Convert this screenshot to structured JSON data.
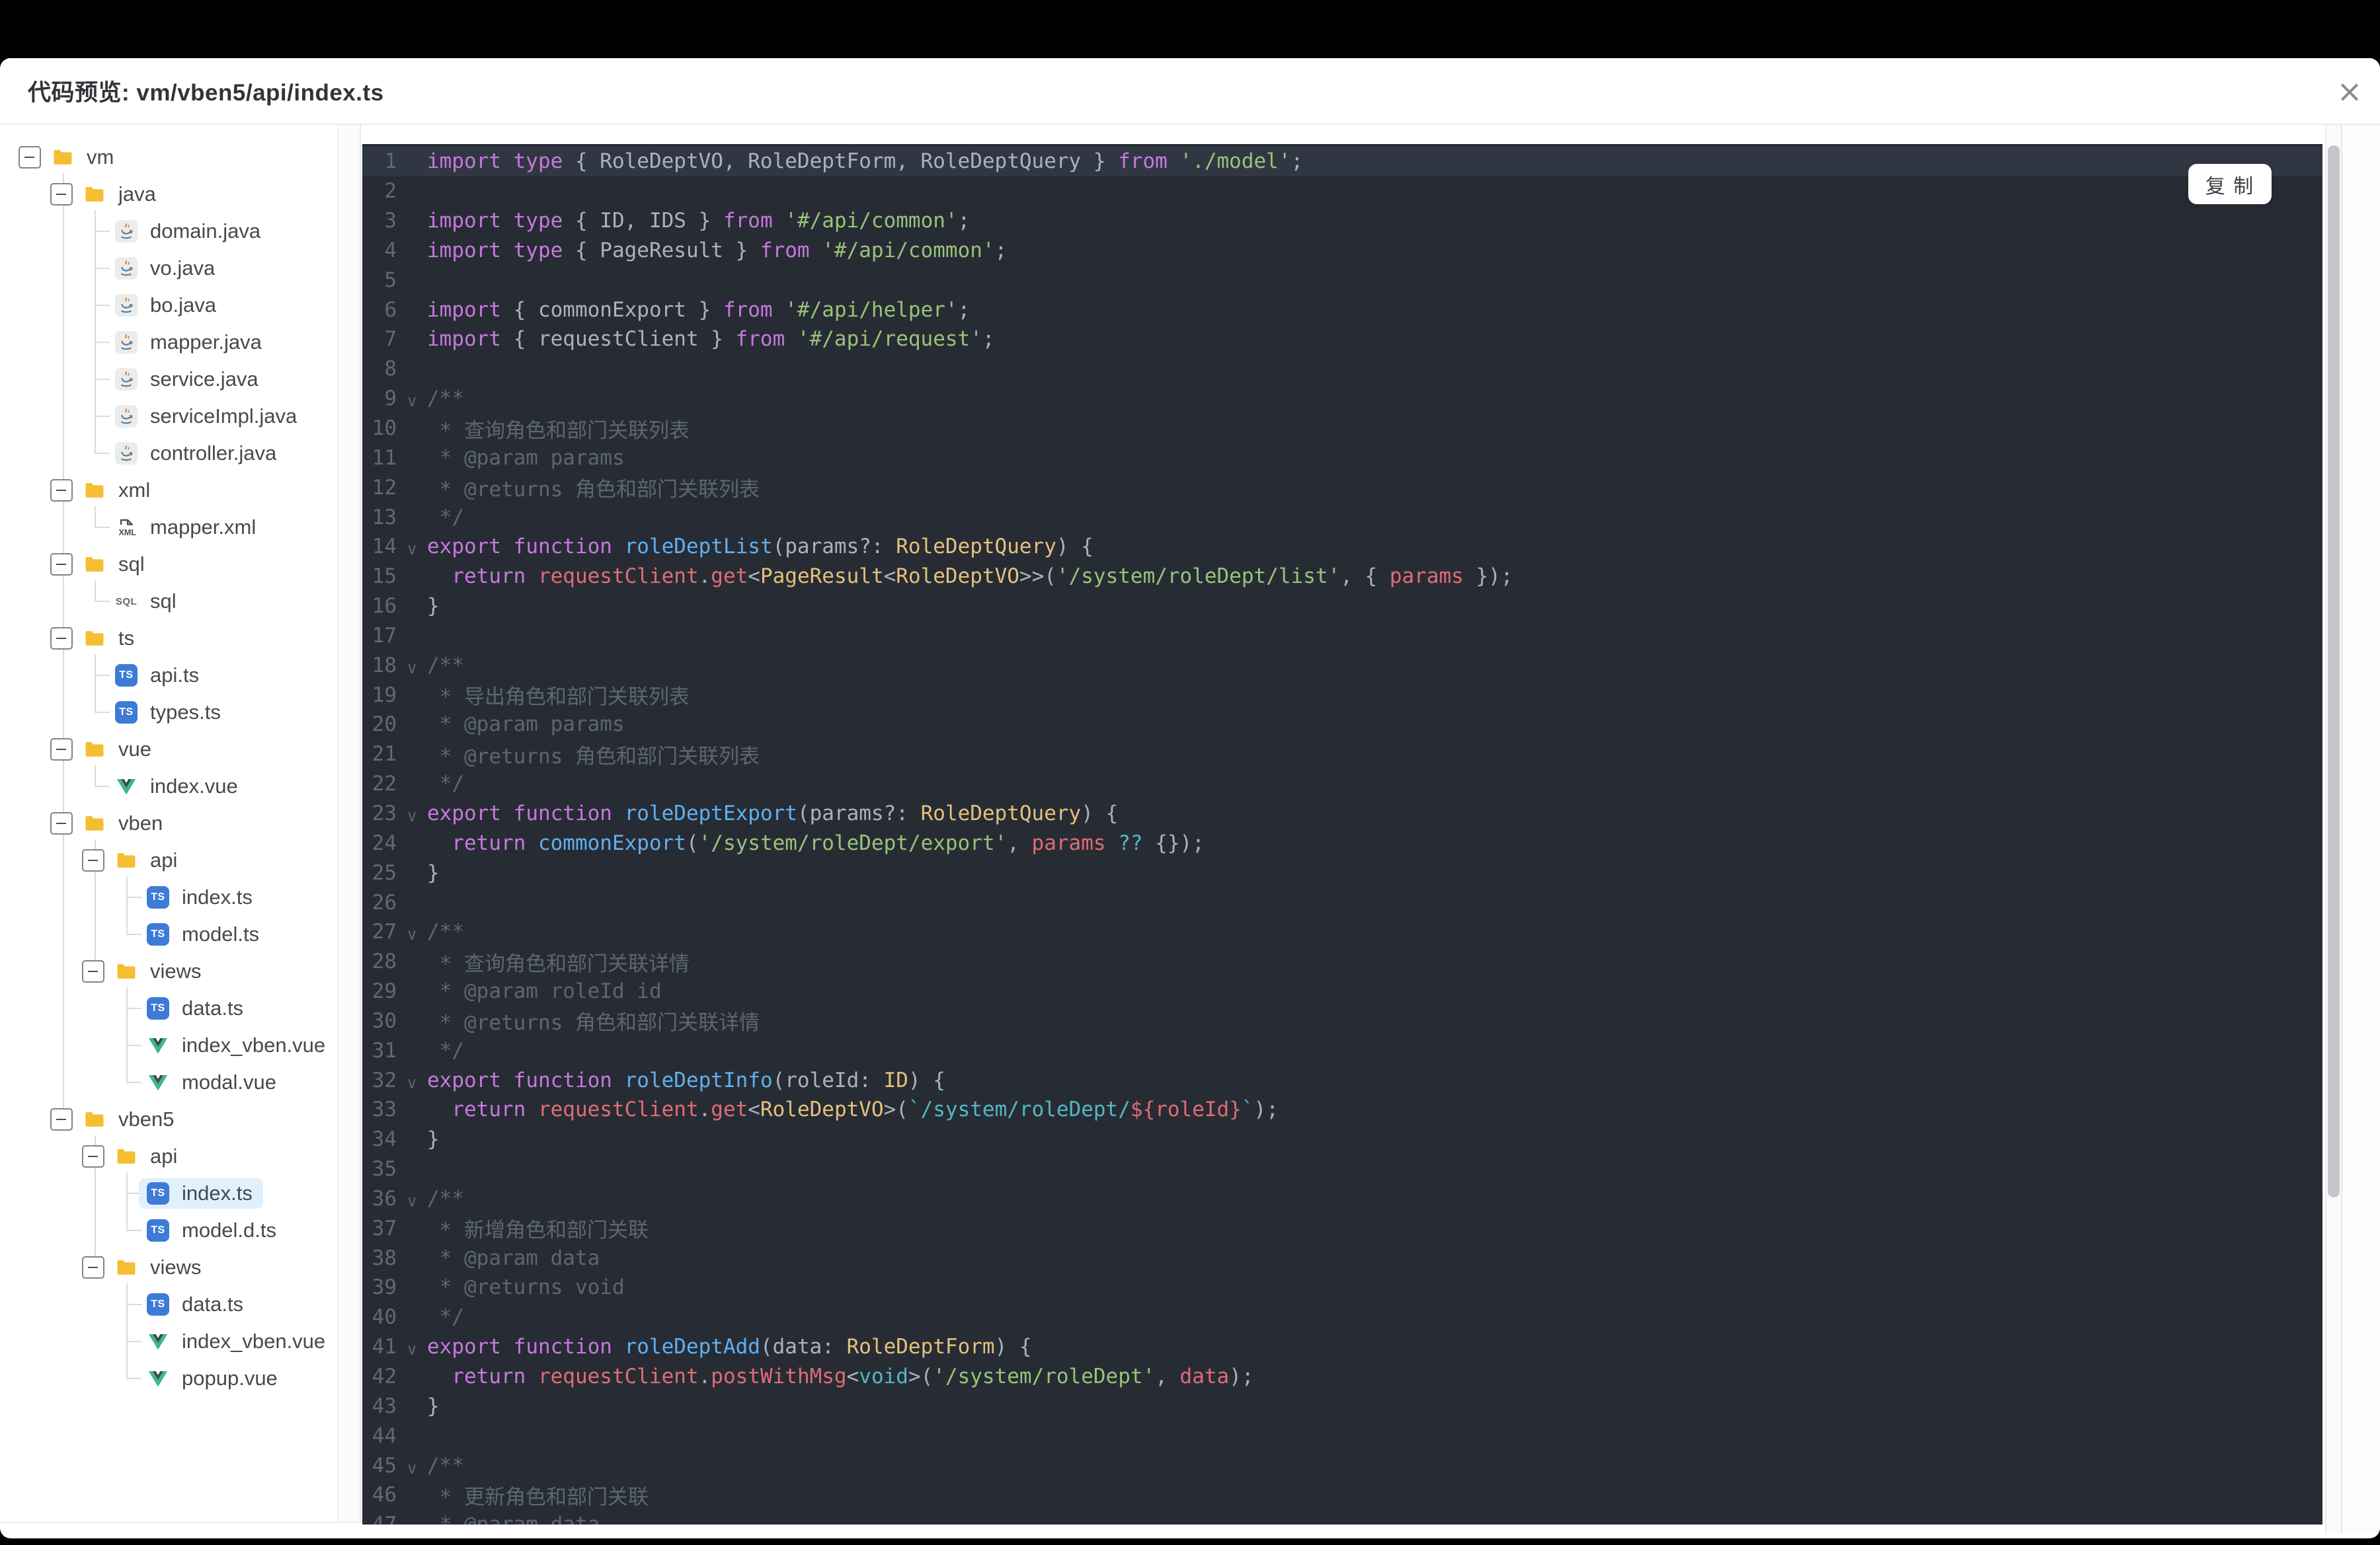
{
  "header": {
    "title": "代码预览: vm/vben5/api/index.ts",
    "close_glyph": "×"
  },
  "code_panel": {
    "copy_label": "复 制"
  },
  "tree": {
    "rows": [
      {
        "level": 0,
        "icon": "folder",
        "label": "vm",
        "toggle": true
      },
      {
        "level": 1,
        "icon": "folder",
        "label": "java",
        "toggle": true
      },
      {
        "level": 2,
        "icon": "java",
        "label": "domain.java"
      },
      {
        "level": 2,
        "icon": "java",
        "label": "vo.java"
      },
      {
        "level": 2,
        "icon": "java",
        "label": "bo.java"
      },
      {
        "level": 2,
        "icon": "java",
        "label": "mapper.java"
      },
      {
        "level": 2,
        "icon": "java",
        "label": "service.java"
      },
      {
        "level": 2,
        "icon": "java",
        "label": "serviceImpl.java"
      },
      {
        "level": 2,
        "icon": "java",
        "label": "controller.java"
      },
      {
        "level": 1,
        "icon": "folder",
        "label": "xml",
        "toggle": true
      },
      {
        "level": 2,
        "icon": "xml",
        "label": "mapper.xml"
      },
      {
        "level": 1,
        "icon": "folder",
        "label": "sql",
        "toggle": true
      },
      {
        "level": 2,
        "icon": "sql",
        "label": "sql"
      },
      {
        "level": 1,
        "icon": "folder",
        "label": "ts",
        "toggle": true
      },
      {
        "level": 2,
        "icon": "ts",
        "label": "api.ts"
      },
      {
        "level": 2,
        "icon": "ts",
        "label": "types.ts"
      },
      {
        "level": 1,
        "icon": "folder",
        "label": "vue",
        "toggle": true
      },
      {
        "level": 2,
        "icon": "vue",
        "label": "index.vue"
      },
      {
        "level": 1,
        "icon": "folder",
        "label": "vben",
        "toggle": true
      },
      {
        "level": 2,
        "icon": "folder",
        "label": "api",
        "toggle": true
      },
      {
        "level": 3,
        "icon": "ts",
        "label": "index.ts"
      },
      {
        "level": 3,
        "icon": "ts",
        "label": "model.ts"
      },
      {
        "level": 2,
        "icon": "folder",
        "label": "views",
        "toggle": true
      },
      {
        "level": 3,
        "icon": "ts",
        "label": "data.ts"
      },
      {
        "level": 3,
        "icon": "vue",
        "label": "index_vben.vue"
      },
      {
        "level": 3,
        "icon": "vue",
        "label": "modal.vue"
      },
      {
        "level": 1,
        "icon": "folder",
        "label": "vben5",
        "toggle": true
      },
      {
        "level": 2,
        "icon": "folder",
        "label": "api",
        "toggle": true
      },
      {
        "level": 3,
        "icon": "ts",
        "label": "index.ts",
        "selected": true
      },
      {
        "level": 3,
        "icon": "ts",
        "label": "model.d.ts"
      },
      {
        "level": 2,
        "icon": "folder",
        "label": "views",
        "toggle": true
      },
      {
        "level": 3,
        "icon": "ts",
        "label": "data.ts"
      },
      {
        "level": 3,
        "icon": "vue",
        "label": "index_vben.vue"
      },
      {
        "level": 3,
        "icon": "vue",
        "label": "popup.vue"
      }
    ]
  },
  "code": {
    "lines": [
      {
        "n": 1,
        "active": true,
        "t": [
          [
            "k",
            "import type"
          ],
          [
            "d",
            " { RoleDeptVO, RoleDeptForm, RoleDeptQuery } "
          ],
          [
            "k",
            "from"
          ],
          [
            "d",
            " "
          ],
          [
            "s",
            "'./model'"
          ],
          [
            "d",
            ";"
          ]
        ]
      },
      {
        "n": 2,
        "t": []
      },
      {
        "n": 3,
        "t": [
          [
            "k",
            "import type"
          ],
          [
            "d",
            " { ID, IDS } "
          ],
          [
            "k",
            "from"
          ],
          [
            "d",
            " "
          ],
          [
            "s",
            "'#/api/common'"
          ],
          [
            "d",
            ";"
          ]
        ]
      },
      {
        "n": 4,
        "t": [
          [
            "k",
            "import type"
          ],
          [
            "d",
            " { PageResult } "
          ],
          [
            "k",
            "from"
          ],
          [
            "d",
            " "
          ],
          [
            "s",
            "'#/api/common'"
          ],
          [
            "d",
            ";"
          ]
        ]
      },
      {
        "n": 5,
        "t": []
      },
      {
        "n": 6,
        "t": [
          [
            "k",
            "import"
          ],
          [
            "d",
            " { commonExport } "
          ],
          [
            "k",
            "from"
          ],
          [
            "d",
            " "
          ],
          [
            "s",
            "'#/api/helper'"
          ],
          [
            "d",
            ";"
          ]
        ]
      },
      {
        "n": 7,
        "t": [
          [
            "k",
            "import"
          ],
          [
            "d",
            " { requestClient } "
          ],
          [
            "k",
            "from"
          ],
          [
            "d",
            " "
          ],
          [
            "s",
            "'#/api/request'"
          ],
          [
            "d",
            ";"
          ]
        ]
      },
      {
        "n": 8,
        "t": []
      },
      {
        "n": 9,
        "fold": true,
        "t": [
          [
            "c",
            "/**"
          ]
        ]
      },
      {
        "n": 10,
        "t": [
          [
            "c",
            " * 查询角色和部门关联列表"
          ]
        ]
      },
      {
        "n": 11,
        "t": [
          [
            "c",
            " * @param params"
          ]
        ]
      },
      {
        "n": 12,
        "t": [
          [
            "c",
            " * @returns 角色和部门关联列表"
          ]
        ]
      },
      {
        "n": 13,
        "t": [
          [
            "c",
            " */"
          ]
        ]
      },
      {
        "n": 14,
        "fold": true,
        "t": [
          [
            "k",
            "export"
          ],
          [
            "d",
            " "
          ],
          [
            "k",
            "function"
          ],
          [
            "d",
            " "
          ],
          [
            "f",
            "roleDeptList"
          ],
          [
            "d",
            "(params?: "
          ],
          [
            "t",
            "RoleDeptQuery"
          ],
          [
            "d",
            ") {"
          ]
        ]
      },
      {
        "n": 15,
        "t": [
          [
            "d",
            "  "
          ],
          [
            "k",
            "return"
          ],
          [
            "d",
            " "
          ],
          [
            "r",
            "requestClient"
          ],
          [
            "d",
            "."
          ],
          [
            "r",
            "get"
          ],
          [
            "d",
            "<"
          ],
          [
            "t",
            "PageResult"
          ],
          [
            "d",
            "<"
          ],
          [
            "t",
            "RoleDeptVO"
          ],
          [
            "d",
            ">>("
          ],
          [
            "s",
            "'/system/roleDept/list'"
          ],
          [
            "d",
            ", { "
          ],
          [
            "r",
            "params"
          ],
          [
            "d",
            " });"
          ]
        ]
      },
      {
        "n": 16,
        "t": [
          [
            "d",
            "}"
          ]
        ]
      },
      {
        "n": 17,
        "t": []
      },
      {
        "n": 18,
        "fold": true,
        "t": [
          [
            "c",
            "/**"
          ]
        ]
      },
      {
        "n": 19,
        "t": [
          [
            "c",
            " * 导出角色和部门关联列表"
          ]
        ]
      },
      {
        "n": 20,
        "t": [
          [
            "c",
            " * @param params"
          ]
        ]
      },
      {
        "n": 21,
        "t": [
          [
            "c",
            " * @returns 角色和部门关联列表"
          ]
        ]
      },
      {
        "n": 22,
        "t": [
          [
            "c",
            " */"
          ]
        ]
      },
      {
        "n": 23,
        "fold": true,
        "t": [
          [
            "k",
            "export"
          ],
          [
            "d",
            " "
          ],
          [
            "k",
            "function"
          ],
          [
            "d",
            " "
          ],
          [
            "f",
            "roleDeptExport"
          ],
          [
            "d",
            "(params?: "
          ],
          [
            "t",
            "RoleDeptQuery"
          ],
          [
            "d",
            ") {"
          ]
        ]
      },
      {
        "n": 24,
        "t": [
          [
            "d",
            "  "
          ],
          [
            "k",
            "return"
          ],
          [
            "d",
            " "
          ],
          [
            "f",
            "commonExport"
          ],
          [
            "d",
            "("
          ],
          [
            "s",
            "'/system/roleDept/export'"
          ],
          [
            "d",
            ", "
          ],
          [
            "r",
            "params"
          ],
          [
            "d",
            " "
          ],
          [
            "o",
            "??"
          ],
          [
            "d",
            " {});"
          ]
        ]
      },
      {
        "n": 25,
        "t": [
          [
            "d",
            "}"
          ]
        ]
      },
      {
        "n": 26,
        "t": []
      },
      {
        "n": 27,
        "fold": true,
        "t": [
          [
            "c",
            "/**"
          ]
        ]
      },
      {
        "n": 28,
        "t": [
          [
            "c",
            " * 查询角色和部门关联详情"
          ]
        ]
      },
      {
        "n": 29,
        "t": [
          [
            "c",
            " * @param roleId id"
          ]
        ]
      },
      {
        "n": 30,
        "t": [
          [
            "c",
            " * @returns 角色和部门关联详情"
          ]
        ]
      },
      {
        "n": 31,
        "t": [
          [
            "c",
            " */"
          ]
        ]
      },
      {
        "n": 32,
        "fold": true,
        "t": [
          [
            "k",
            "export"
          ],
          [
            "d",
            " "
          ],
          [
            "k",
            "function"
          ],
          [
            "d",
            " "
          ],
          [
            "f",
            "roleDeptInfo"
          ],
          [
            "d",
            "(roleId: "
          ],
          [
            "t",
            "ID"
          ],
          [
            "d",
            ") {"
          ]
        ]
      },
      {
        "n": 33,
        "t": [
          [
            "d",
            "  "
          ],
          [
            "k",
            "return"
          ],
          [
            "d",
            " "
          ],
          [
            "r",
            "requestClient"
          ],
          [
            "d",
            "."
          ],
          [
            "r",
            "get"
          ],
          [
            "d",
            "<"
          ],
          [
            "t",
            "RoleDeptVO"
          ],
          [
            "d",
            ">("
          ],
          [
            "o",
            "`/system/roleDept/"
          ],
          [
            "r",
            "${roleId}"
          ],
          [
            "o",
            "`"
          ],
          [
            "d",
            ");"
          ]
        ]
      },
      {
        "n": 34,
        "t": [
          [
            "d",
            "}"
          ]
        ]
      },
      {
        "n": 35,
        "t": []
      },
      {
        "n": 36,
        "fold": true,
        "t": [
          [
            "c",
            "/**"
          ]
        ]
      },
      {
        "n": 37,
        "t": [
          [
            "c",
            " * 新增角色和部门关联"
          ]
        ]
      },
      {
        "n": 38,
        "t": [
          [
            "c",
            " * @param data"
          ]
        ]
      },
      {
        "n": 39,
        "t": [
          [
            "c",
            " * @returns void"
          ]
        ]
      },
      {
        "n": 40,
        "t": [
          [
            "c",
            " */"
          ]
        ]
      },
      {
        "n": 41,
        "fold": true,
        "t": [
          [
            "k",
            "export"
          ],
          [
            "d",
            " "
          ],
          [
            "k",
            "function"
          ],
          [
            "d",
            " "
          ],
          [
            "f",
            "roleDeptAdd"
          ],
          [
            "d",
            "(data: "
          ],
          [
            "t",
            "RoleDeptForm"
          ],
          [
            "d",
            ") {"
          ]
        ]
      },
      {
        "n": 42,
        "t": [
          [
            "d",
            "  "
          ],
          [
            "k",
            "return"
          ],
          [
            "d",
            " "
          ],
          [
            "r",
            "requestClient"
          ],
          [
            "d",
            "."
          ],
          [
            "r",
            "postWithMsg"
          ],
          [
            "d",
            "<"
          ],
          [
            "o",
            "void"
          ],
          [
            "d",
            ">("
          ],
          [
            "s",
            "'/system/roleDept'"
          ],
          [
            "d",
            ", "
          ],
          [
            "r",
            "data"
          ],
          [
            "d",
            ");"
          ]
        ]
      },
      {
        "n": 43,
        "t": [
          [
            "d",
            "}"
          ]
        ]
      },
      {
        "n": 44,
        "t": []
      },
      {
        "n": 45,
        "fold": true,
        "t": [
          [
            "c",
            "/**"
          ]
        ]
      },
      {
        "n": 46,
        "t": [
          [
            "c",
            " * 更新角色和部门关联"
          ]
        ]
      },
      {
        "n": 47,
        "t": [
          [
            "c",
            " * @param data"
          ]
        ]
      }
    ]
  },
  "colors": {
    "code_bg": "#272c34",
    "active_line_bg": "#313742",
    "keyword": "#c678dd",
    "string": "#98c379",
    "type": "#e5c07b",
    "function": "#61afef",
    "variable": "#e06c75",
    "comment": "#5c6673",
    "operator": "#56b6c2",
    "text": "#abb2bf",
    "line_number": "#60687a",
    "folder": "#f5be32",
    "ts_badge": "#3e7bd6",
    "selected_bg": "#e1f0fd",
    "vue_green": "#41b883",
    "vue_dark": "#35495e"
  }
}
